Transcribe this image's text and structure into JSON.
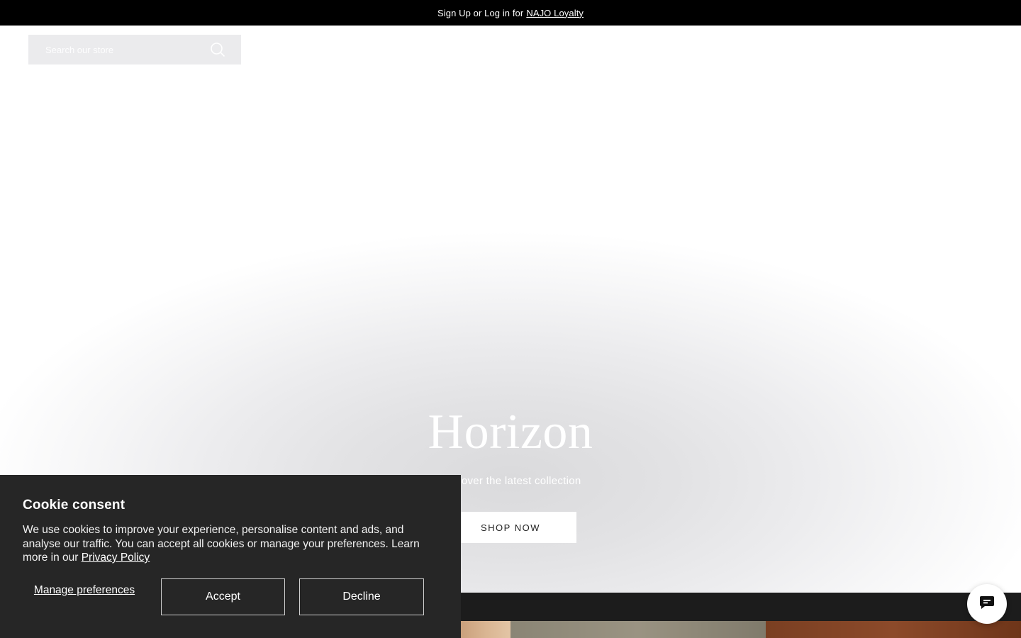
{
  "announcement": {
    "prefix": "Sign Up or Log in for",
    "link": "NAJO Loyalty"
  },
  "search": {
    "placeholder": "Search our store",
    "icon": "search-icon"
  },
  "hero": {
    "title": "Horizon",
    "subtitle": "Discover the latest collection",
    "cta": "SHOP NOW"
  },
  "cookie": {
    "title": "Cookie consent",
    "body": "We use cookies to improve your experience, personalise content and ads, and analyse our traffic. You can accept all cookies or manage your preferences. Learn more in our",
    "privacy_link": "Privacy Policy",
    "manage_label": "Manage preferences",
    "accept_label": "Accept",
    "decline_label": "Decline"
  },
  "chat": {
    "icon": "chat-icon"
  },
  "colors": {
    "announcement_bg": "#000000",
    "cookie_bg": "#262626",
    "dark_strip": "#1c1c1c"
  }
}
